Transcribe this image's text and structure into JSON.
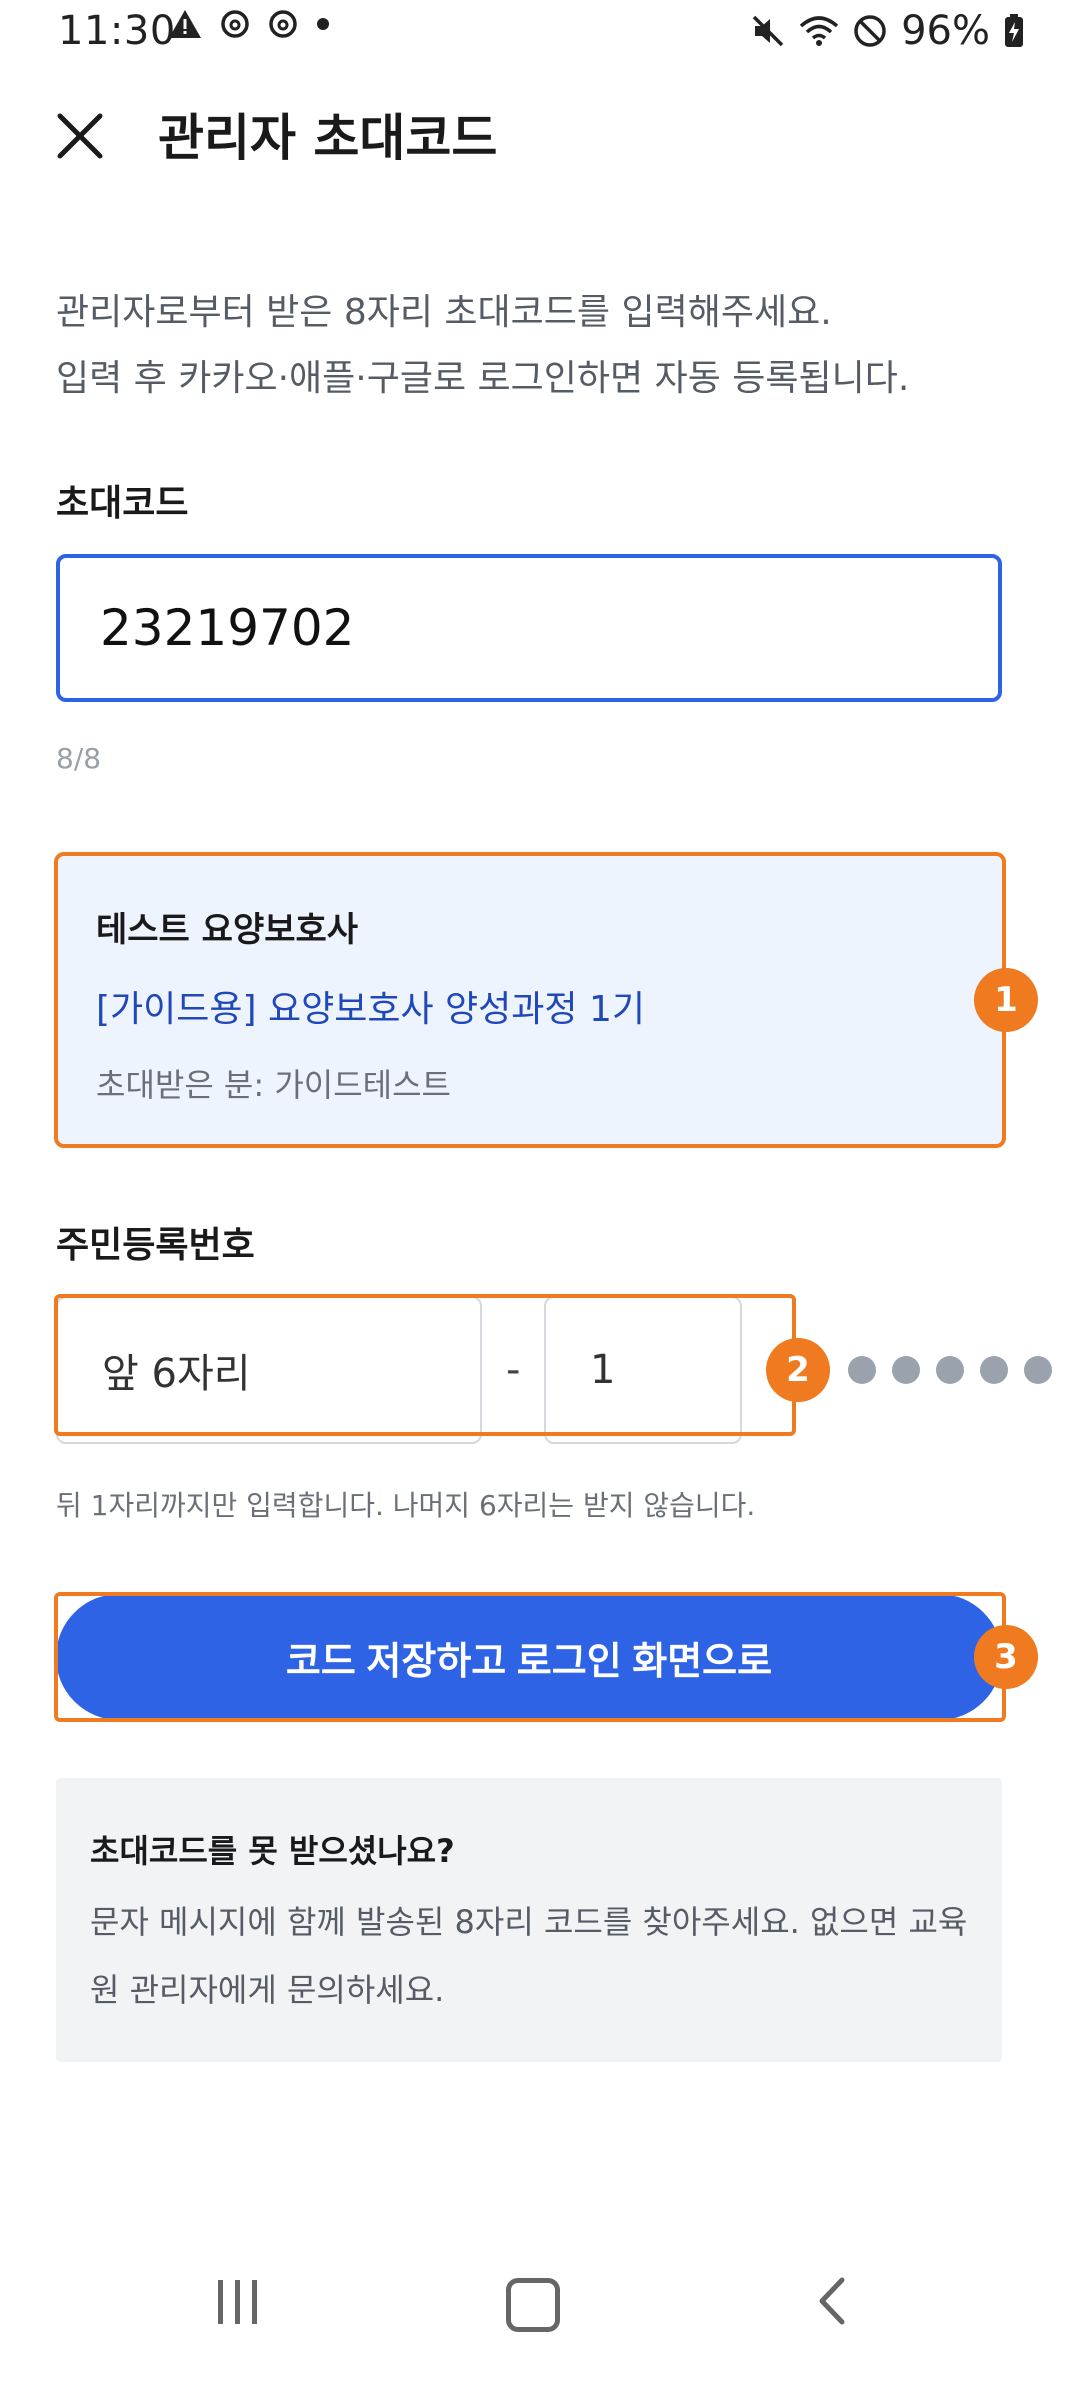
{
  "status_bar": {
    "time": "11:30",
    "battery": "96%",
    "icons_left": [
      "warning-icon",
      "threads-icon",
      "threads-icon",
      "dot-icon"
    ],
    "icons_right": [
      "mute-icon",
      "wifi-icon",
      "dnd-icon",
      "battery-icon"
    ]
  },
  "header": {
    "title": "관리자 초대코드",
    "close_icon": "close-icon"
  },
  "description": {
    "line1": "관리자로부터 받은 8자리 초대코드를 입력해주세요.",
    "line2": "입력 후 카카오·애플·구글로 로그인하면 자동 등록됩니다."
  },
  "invite_code": {
    "label": "초대코드",
    "value": "23219702",
    "counter": "8/8"
  },
  "info_card": {
    "name": "테스트 요양보호사",
    "course": "[가이드용] 요양보호사 양성과정 1기",
    "invitee": "초대받은 분: 가이드테스트",
    "badge": "1"
  },
  "rrn": {
    "label": "주민등록번호",
    "front_placeholder": "앞 6자리",
    "separator": "-",
    "back_value": "1",
    "badge": "2",
    "masked_count": 5,
    "help": "뒤 1자리까지만 입력합니다. 나머지 6자리는 받지 않습니다."
  },
  "primary_button": {
    "label": "코드 저장하고 로그인 화면으로",
    "badge": "3"
  },
  "help_box": {
    "title": "초대코드를 못 받으셨나요?",
    "body": "문자 메시지에 함께 발송된 8자리 코드를 찾아주세요. 없으면 교육원 관리자에게 문의하세요."
  },
  "colors": {
    "primary": "#2f63e6",
    "highlight": "#f07a1f",
    "card_bg": "#eef4fe",
    "link": "#2148b8"
  }
}
